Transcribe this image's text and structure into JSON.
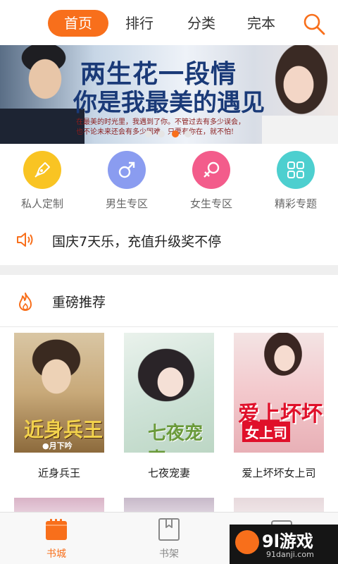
{
  "topnav": {
    "tabs": [
      "首页",
      "排行",
      "分类",
      "完本"
    ],
    "active_tab": "首页",
    "search_icon": "search-icon"
  },
  "banner": {
    "title_line1": "两生花一段情",
    "title_line2": "你是我最美的遇见",
    "subtitle_line1": "在最美的时光里，我遇到了你。不管过去有多少误会，",
    "subtitle_line2": "也不论未来还会有多少困难，只要有你在，就不怕!",
    "slide_count": 4,
    "active_slide": 3
  },
  "categories": [
    {
      "label": "私人定制",
      "icon": "pen-icon",
      "color": "#f9c423"
    },
    {
      "label": "男生专区",
      "icon": "male-icon",
      "color": "#8a9cf0"
    },
    {
      "label": "女生专区",
      "icon": "female-icon",
      "color": "#f35c8b"
    },
    {
      "label": "精彩专题",
      "icon": "grid-icon",
      "color": "#4dcfcf"
    }
  ],
  "notice": {
    "icon": "speaker-icon",
    "text": "国庆7天乐，充值升级奖不停"
  },
  "section": {
    "icon": "fire-icon",
    "title": "重磅推荐"
  },
  "books": [
    {
      "title": "近身兵王",
      "cover_title": "近身兵王",
      "cover_author": "●月下吟"
    },
    {
      "title": "七夜宠妻",
      "cover_title": "七夜宠妻"
    },
    {
      "title": "爱上坏坏女上司",
      "cover_title": "爱上坏坏",
      "cover_subtitle": "女上司"
    }
  ],
  "bottombar": {
    "items": [
      {
        "label": "书城",
        "icon": "bookstore-icon",
        "active": true
      },
      {
        "label": "书架",
        "icon": "bookshelf-icon",
        "active": false
      },
      {
        "label": "",
        "icon": "profile-icon",
        "active": false
      }
    ]
  },
  "watermark": {
    "logo": "9l游戏",
    "url": "91danji.com"
  },
  "colors": {
    "accent": "#f86f1b",
    "text": "#222222",
    "muted": "#666666"
  }
}
